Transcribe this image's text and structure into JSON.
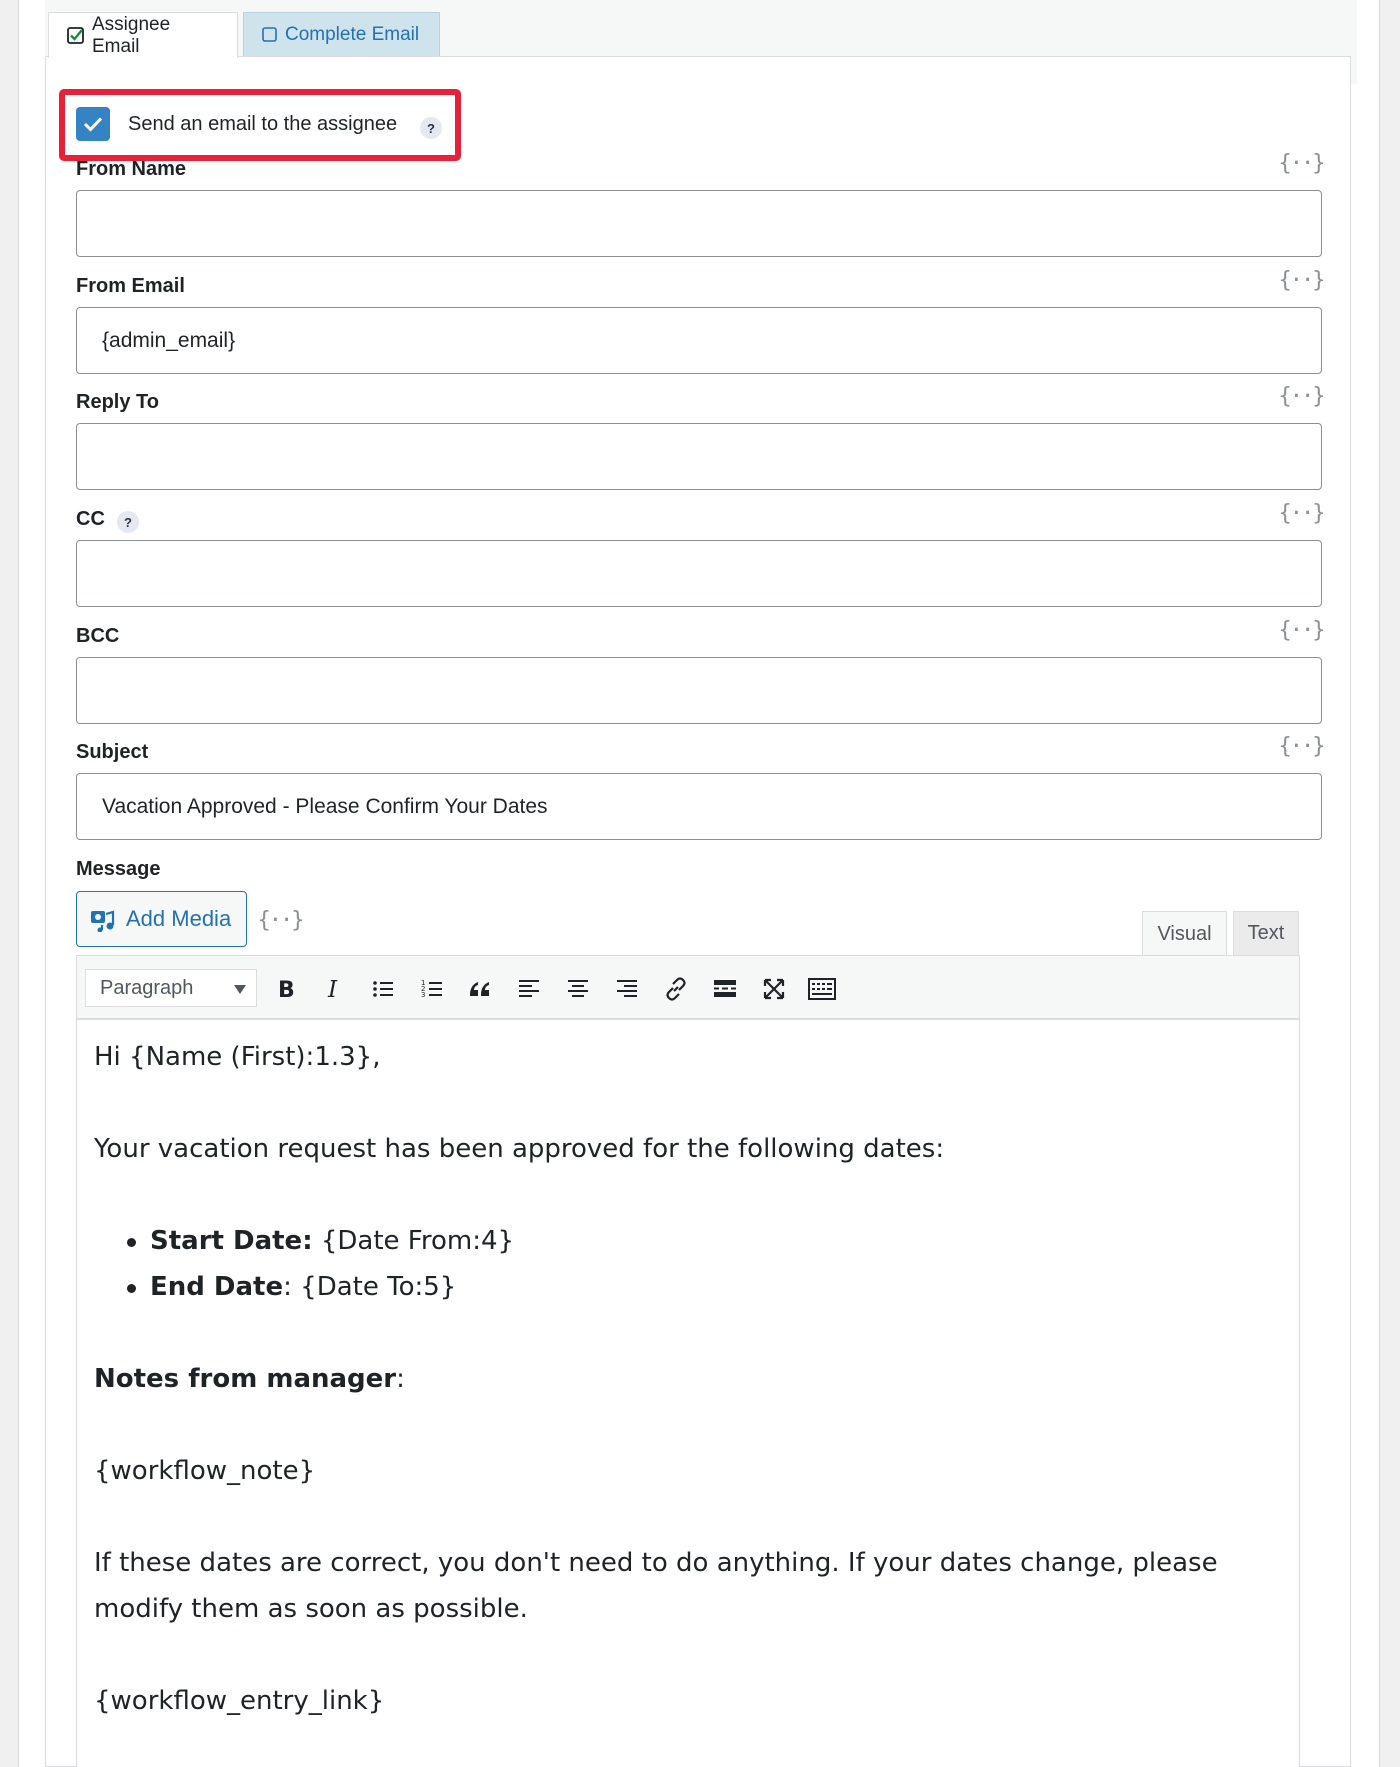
{
  "tabs": [
    {
      "label": "Assignee Email",
      "checked": true
    },
    {
      "label": "Complete Email",
      "checked": false
    }
  ],
  "send_email": {
    "label": "Send an email to the assignee",
    "checked": true,
    "help": "?"
  },
  "fields": {
    "from_name": {
      "label": "From Name",
      "value": ""
    },
    "from_email": {
      "label": "From Email",
      "value": "{admin_email}"
    },
    "reply_to": {
      "label": "Reply To",
      "value": ""
    },
    "cc": {
      "label": "CC",
      "value": "",
      "help": "?"
    },
    "bcc": {
      "label": "BCC",
      "value": ""
    },
    "subject": {
      "label": "Subject",
      "value": "Vacation Approved - Please Confirm Your Dates"
    }
  },
  "merge_tag_icon": "{··}",
  "message": {
    "label": "Message",
    "add_media_label": "Add Media",
    "editor_tabs": [
      "Visual",
      "Text"
    ],
    "format_select": "Paragraph",
    "toolbar_icons": [
      "bold-icon",
      "italic-icon",
      "bullet-list-icon",
      "numbered-list-icon",
      "blockquote-icon",
      "align-left-icon",
      "align-center-icon",
      "align-right-icon",
      "link-icon",
      "read-more-icon",
      "fullscreen-icon",
      "toolbar-toggle-icon"
    ],
    "body": {
      "greeting": "Hi {Name (First):1.3},",
      "intro": "Your vacation request has been approved for the following dates:",
      "items": [
        {
          "label": "Start Date:",
          "value": " {Date From:4}"
        },
        {
          "label": "End Date",
          "value": ": {Date To:5}"
        }
      ],
      "notes_label": "Notes from manager",
      "notes_suffix": ":",
      "workflow_note": "{workflow_note}",
      "closing": "If these dates are correct, you don't need to do anything. If your dates change, please modify them as soon as possible.",
      "entry_link": "{workflow_entry_link}"
    }
  },
  "colors": {
    "accent": "#2271b1",
    "checkbox": "#3582c4",
    "highlight": "#e8213a"
  }
}
